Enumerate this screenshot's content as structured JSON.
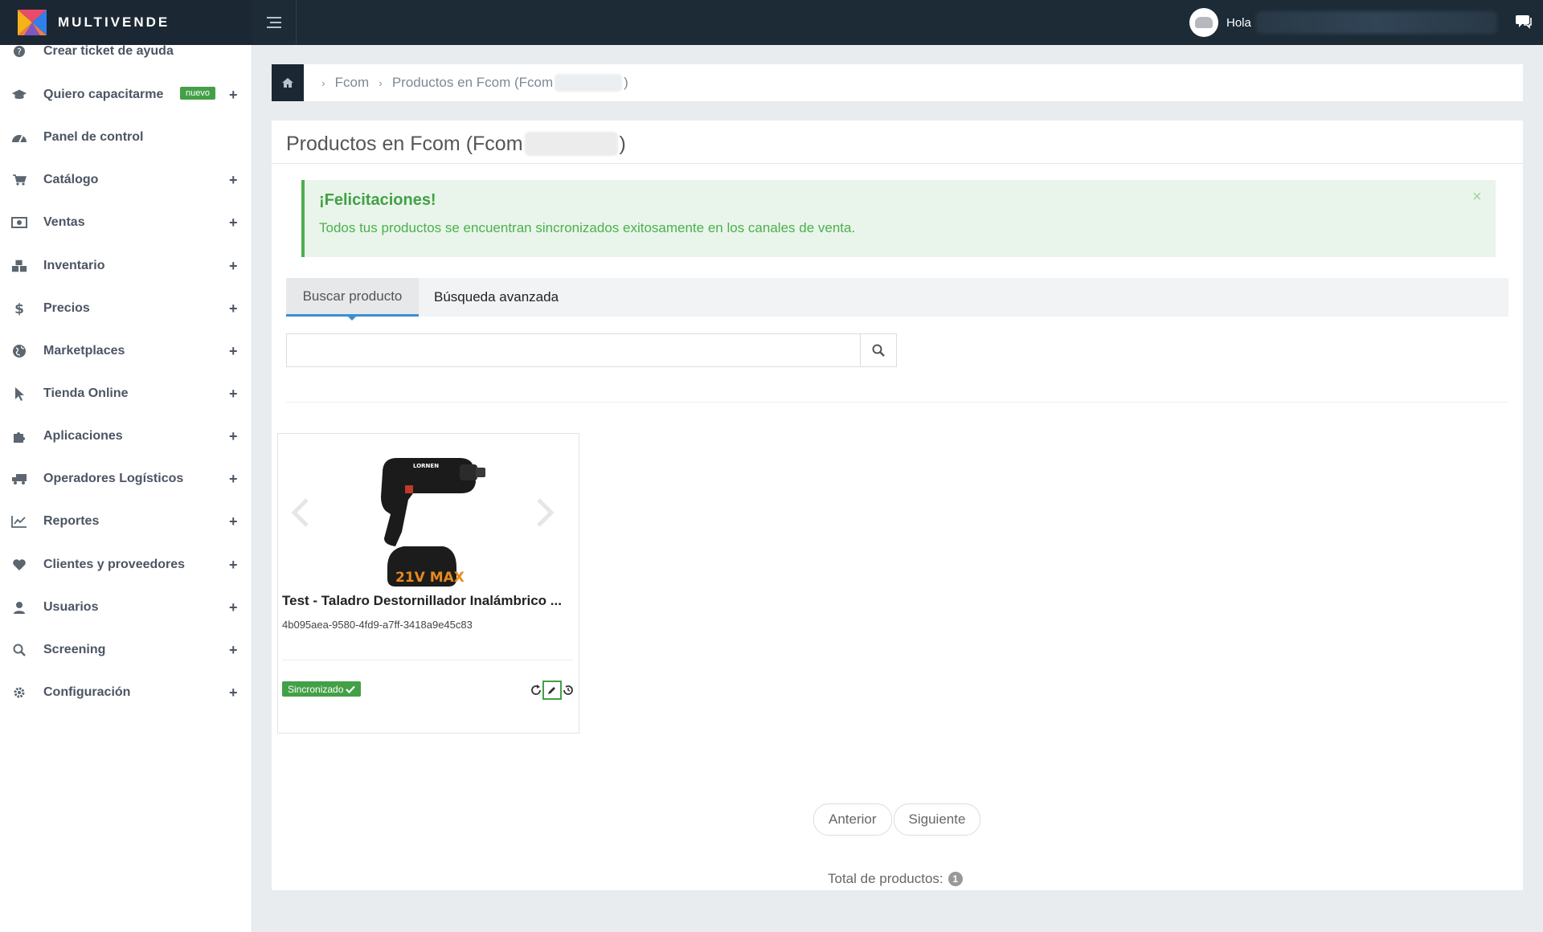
{
  "app": {
    "brand": "MULTIVENDE",
    "hello": "Hola"
  },
  "sidebar": {
    "items": [
      {
        "label": "Crear ticket de ayuda",
        "icon": "help-circle-icon",
        "plus": false,
        "badge": ""
      },
      {
        "label": "Quiero capacitarme",
        "icon": "graduation-cap-icon",
        "plus": true,
        "badge": "nuevo"
      },
      {
        "label": "Panel de control",
        "icon": "dashboard-icon",
        "plus": false,
        "badge": ""
      },
      {
        "label": "Catálogo",
        "icon": "cart-icon",
        "plus": true,
        "badge": ""
      },
      {
        "label": "Ventas",
        "icon": "money-icon",
        "plus": true,
        "badge": ""
      },
      {
        "label": "Inventario",
        "icon": "cubes-icon",
        "plus": true,
        "badge": ""
      },
      {
        "label": "Precios",
        "icon": "dollar-icon",
        "plus": true,
        "badge": ""
      },
      {
        "label": "Marketplaces",
        "icon": "globe-icon",
        "plus": true,
        "badge": ""
      },
      {
        "label": "Tienda Online",
        "icon": "pointer-icon",
        "plus": true,
        "badge": ""
      },
      {
        "label": "Aplicaciones",
        "icon": "puzzle-icon",
        "plus": true,
        "badge": ""
      },
      {
        "label": "Operadores Logísticos",
        "icon": "truck-icon",
        "plus": true,
        "badge": ""
      },
      {
        "label": "Reportes",
        "icon": "line-chart-icon",
        "plus": true,
        "badge": ""
      },
      {
        "label": "Clientes y proveedores",
        "icon": "heart-icon",
        "plus": true,
        "badge": ""
      },
      {
        "label": "Usuarios",
        "icon": "user-icon",
        "plus": true,
        "badge": ""
      },
      {
        "label": "Screening",
        "icon": "search-icon",
        "plus": true,
        "badge": ""
      },
      {
        "label": "Configuración",
        "icon": "gear-icon",
        "plus": true,
        "badge": ""
      }
    ],
    "plus_symbol": "+"
  },
  "breadcrumb": {
    "items": [
      "Fcom",
      "Productos en Fcom (Fcom"
    ],
    "closing": ")",
    "separator": "›"
  },
  "page": {
    "title_prefix": "Productos en Fcom (Fcom",
    "title_suffix": ")"
  },
  "alert": {
    "title": "¡Felicitaciones!",
    "text": "Todos tus productos se encuentran sincronizados exitosamente en los canales de venta.",
    "close": "×"
  },
  "tabs": {
    "search": "Buscar producto",
    "advanced": "Búsqueda avanzada"
  },
  "search": {
    "value": "",
    "placeholder": ""
  },
  "product": {
    "title": "Test - Taladro Destornillador Inalámbrico ...",
    "sku": "4b095aea-9580-4fd9-a7ff-3418a9e45c83",
    "status": "Sincronizado",
    "battery_text": "21V MAX",
    "brand_text": "LORNEN"
  },
  "pager": {
    "prev": "Anterior",
    "next": "Siguiente"
  },
  "total": {
    "label": "Total de productos:",
    "count": "1"
  },
  "colors": {
    "topbar": "#1d2b37",
    "accent_green": "#43a047",
    "tab_accent": "#3b8fd1"
  }
}
